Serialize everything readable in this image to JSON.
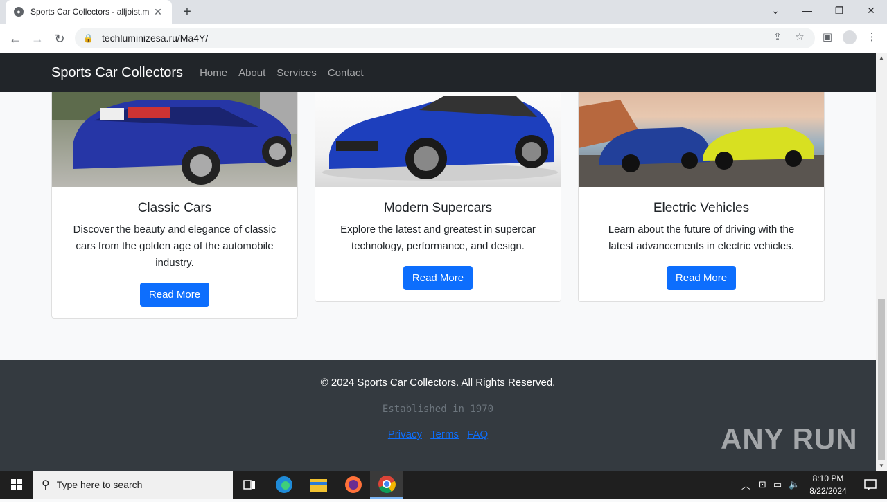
{
  "browser": {
    "tab_title": "Sports Car Collectors - alljoist.m",
    "new_tab": "+",
    "url": "techluminizesa.ru/Ma4Y/"
  },
  "site": {
    "brand": "Sports Car Collectors",
    "nav": [
      "Home",
      "About",
      "Services",
      "Contact"
    ]
  },
  "cards": [
    {
      "title": "Classic Cars",
      "text": "Discover the beauty and elegance of classic cars from the golden age of the automobile industry.",
      "button": "Read More"
    },
    {
      "title": "Modern Supercars",
      "text": "Explore the latest and greatest in supercar technology, performance, and design.",
      "button": "Read More"
    },
    {
      "title": "Electric Vehicles",
      "text": "Learn about the future of driving with the latest advancements in electric vehicles.",
      "button": "Read More"
    }
  ],
  "footer": {
    "copyright": "© 2024 Sports Car Collectors. All Rights Reserved.",
    "established": "Established in 1970",
    "links": [
      "Privacy",
      "Terms",
      "FAQ"
    ]
  },
  "watermark": "ANY RUN",
  "taskbar": {
    "search_placeholder": "Type here to search",
    "time": "8:10 PM",
    "date": "8/22/2024"
  },
  "colors": {
    "navbar": "#212529",
    "footer": "#343a40",
    "primary": "#0d6efd"
  }
}
